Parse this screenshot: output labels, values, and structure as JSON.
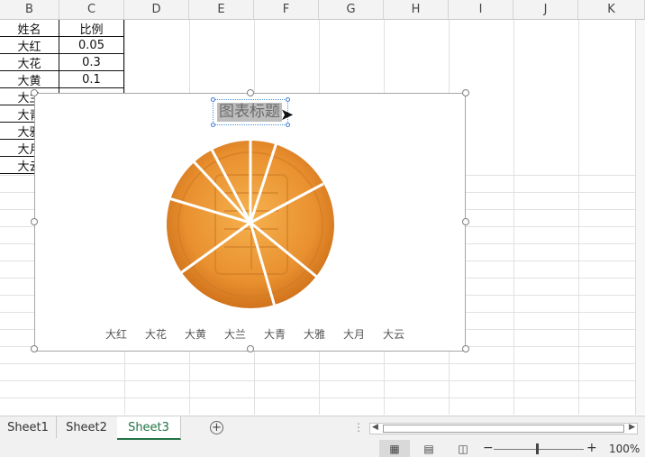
{
  "columns": [
    "B",
    "C",
    "D",
    "E",
    "F",
    "G",
    "H",
    "I",
    "J",
    "K"
  ],
  "table": {
    "headers": [
      "姓名",
      "比例"
    ],
    "rows": [
      {
        "name": "大红",
        "ratio": "0.05"
      },
      {
        "name": "大花",
        "ratio": "0.3"
      },
      {
        "name": "大黄",
        "ratio": "0.1"
      },
      {
        "name": "大兰",
        "ratio": ""
      },
      {
        "name": "大青",
        "ratio": ""
      },
      {
        "name": "大雅",
        "ratio": ""
      },
      {
        "name": "大月",
        "ratio": ""
      },
      {
        "name": "大云",
        "ratio": ""
      }
    ]
  },
  "chart": {
    "title": "图表标题",
    "legend": [
      "大红",
      "大花",
      "大黄",
      "大兰",
      "大青",
      "大雅",
      "大月",
      "大云"
    ],
    "fill_colors": {
      "outer": "#d9791e",
      "inner": "#f2a844",
      "mid": "#e9902f",
      "separator": "#ffffff"
    }
  },
  "sheets": [
    {
      "label": "Sheet1",
      "active": false
    },
    {
      "label": "Sheet2",
      "active": false
    },
    {
      "label": "Sheet3",
      "active": true
    }
  ],
  "status": {
    "zoom": "100%"
  },
  "icons": {
    "add_sheet": "plus-circle-icon",
    "normal_view": "grid-icon",
    "page_layout": "page-icon",
    "page_break": "page-break-icon"
  }
}
